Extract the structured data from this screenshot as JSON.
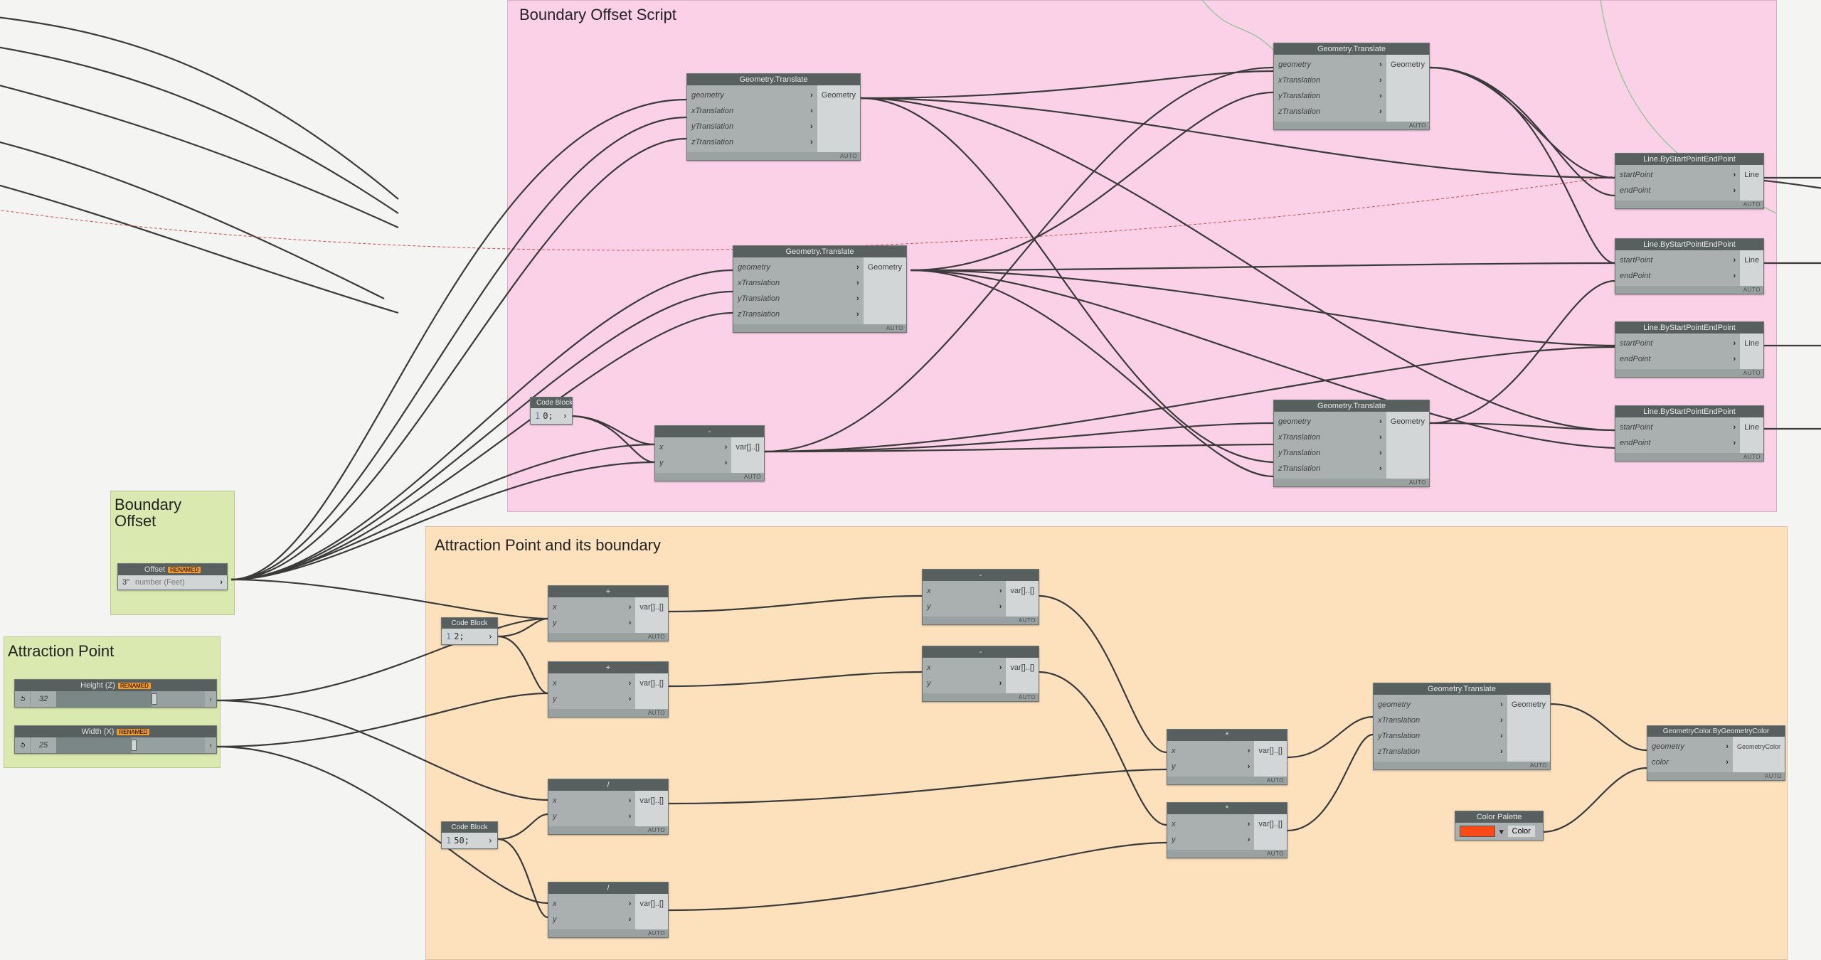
{
  "groups": {
    "boundary_script": {
      "label": "Boundary Offset Script"
    },
    "attraction_group": {
      "label": "Attraction Point and its boundary"
    },
    "boundary_offset": {
      "label": "Boundary\nOffset"
    },
    "attraction_point": {
      "label": "Attraction Point"
    }
  },
  "nodes": {
    "geoTranslate": {
      "title": "Geometry.Translate",
      "ins": [
        "geometry",
        "xTranslation",
        "yTranslation",
        "zTranslation"
      ],
      "out": "Geometry"
    },
    "lineBySE": {
      "title": "Line.ByStartPointEndPoint",
      "ins": [
        "startPoint",
        "endPoint"
      ],
      "out": "Line"
    },
    "codeBlock": {
      "title": "Code Block"
    },
    "cb_0": {
      "line": "1",
      "code": "0;"
    },
    "cb_2": {
      "line": "1",
      "code": "2;"
    },
    "cb_50": {
      "line": "1",
      "code": "50;"
    },
    "op_minus": {
      "title": "-",
      "ins": [
        "x",
        "y"
      ],
      "out": "var[]..[]"
    },
    "op_plus": {
      "title": "+",
      "ins": [
        "x",
        "y"
      ],
      "out": "var[]..[]"
    },
    "op_mul": {
      "title": "*",
      "ins": [
        "x",
        "y"
      ],
      "out": "var[]..[]"
    },
    "op_div": {
      "title": "/",
      "ins": [
        "x",
        "y"
      ],
      "out": "var[]..[]"
    },
    "colorPalette": {
      "title": "Color Palette",
      "out": "Color"
    },
    "geoColor": {
      "title": "GeometryColor.ByGeometryColor",
      "ins": [
        "geometry",
        "color"
      ],
      "out": "GeometryColor"
    },
    "offsetInput": {
      "title": "Offset",
      "badge": "RENAMED",
      "value": "3\"",
      "hint": "number (Feet)"
    },
    "heightSlider": {
      "title": "Height (Z)",
      "badge": "RENAMED",
      "value": "32"
    },
    "widthSlider": {
      "title": "Width (X)",
      "badge": "RENAMED",
      "value": "25"
    }
  },
  "misc": {
    "auto": "AUTO",
    "chev": "›"
  }
}
